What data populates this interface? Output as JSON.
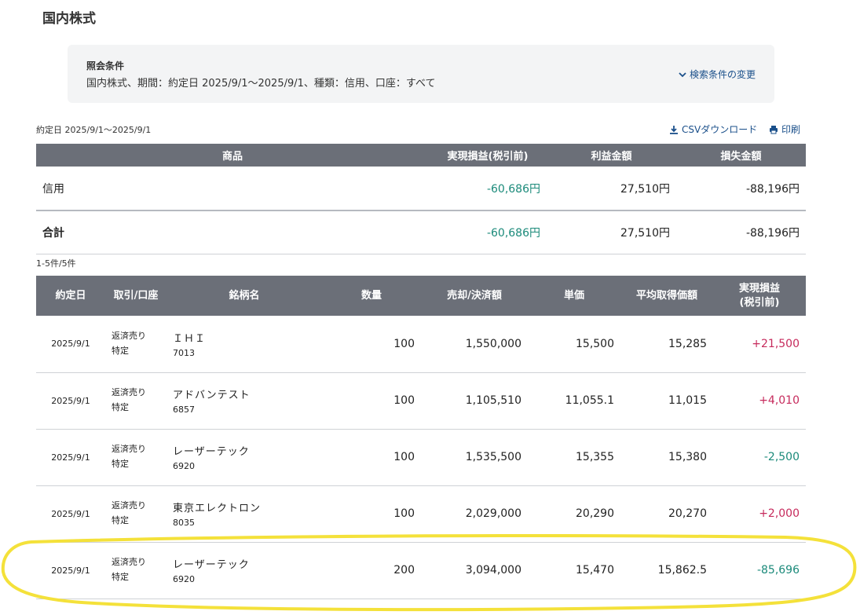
{
  "page_title": "国内株式",
  "conditions": {
    "title": "照会条件",
    "text": "国内株式、期間：約定日 2025/9/1〜2025/9/1、種類：信用、口座：すべて",
    "change_label": "検索条件の変更"
  },
  "period_label": "約定日 2025/9/1〜2025/9/1",
  "csv_label": "CSVダウンロード",
  "print_label": "印刷",
  "summary": {
    "headers": [
      "商品",
      "実現損益(税引前)",
      "利益金額",
      "損失金額"
    ],
    "rows": [
      {
        "product": "信用",
        "pl": "-60,686円",
        "profit": "27,510円",
        "loss": "-88,196円"
      },
      {
        "product": "合計",
        "pl": "-60,686円",
        "profit": "27,510円",
        "loss": "-88,196円"
      }
    ]
  },
  "count_label": "1-5件/5件",
  "detail": {
    "headers": [
      "約定日",
      "取引/口座",
      "銘柄名",
      "数量",
      "売却/決済額",
      "単価",
      "平均取得価額",
      "実現損益",
      "(税引前)"
    ],
    "rows": [
      {
        "date": "2025/9/1",
        "trade": "返済売り",
        "account": "特定",
        "name": "ＩＨＩ",
        "code": "7013",
        "qty": "100",
        "amount": "1,550,000",
        "price": "15,500",
        "avg": "15,285",
        "pl": "+21,500"
      },
      {
        "date": "2025/9/1",
        "trade": "返済売り",
        "account": "特定",
        "name": "アドバンテスト",
        "code": "6857",
        "qty": "100",
        "amount": "1,105,510",
        "price": "11,055.1",
        "avg": "11,015",
        "pl": "+4,010"
      },
      {
        "date": "2025/9/1",
        "trade": "返済売り",
        "account": "特定",
        "name": "レーザーテック",
        "code": "6920",
        "qty": "100",
        "amount": "1,535,500",
        "price": "15,355",
        "avg": "15,380",
        "pl": "-2,500"
      },
      {
        "date": "2025/9/1",
        "trade": "返済売り",
        "account": "特定",
        "name": "東京エレクトロン",
        "code": "8035",
        "qty": "100",
        "amount": "2,029,000",
        "price": "20,290",
        "avg": "20,270",
        "pl": "+2,000"
      },
      {
        "date": "2025/9/1",
        "trade": "返済売り",
        "account": "特定",
        "name": "レーザーテック",
        "code": "6920",
        "qty": "200",
        "amount": "3,094,000",
        "price": "15,470",
        "avg": "15,862.5",
        "pl": "-85,696"
      }
    ]
  },
  "colors": {
    "header_bg": "#6b6f78",
    "loss": "#1b8a7a",
    "gain": "#c62a5c",
    "highlight": "#f4e13a",
    "link": "#1a4f8a"
  },
  "icons": [
    "chevron-down-icon",
    "download-icon",
    "print-icon"
  ]
}
